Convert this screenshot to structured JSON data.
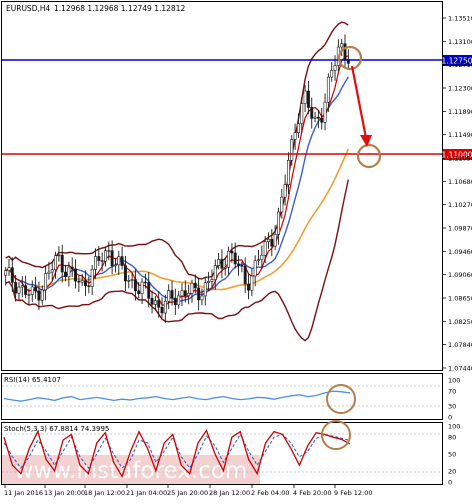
{
  "header": {
    "symbol_tf": "EURUSD,H4",
    "ohlc": "1.12968 1.12968 1.12749 1.12812"
  },
  "rsi_label": "RSI(14) 65.4107",
  "stoch_label": "Stoch(5,3,3) 67.8814 74.3995",
  "watermark": "www.instaforex.com",
  "x_labels": [
    "11 Jan 2016",
    "13 Jan 20:00",
    "18 Jan 12:00",
    "21 Jan 04:00",
    "25 Jan 20:00",
    "28 Jan 12:00",
    "2 Feb 04:00",
    "4 Feb 20:00",
    "9 Feb 12:00"
  ],
  "colors": {
    "candle": "#1a1a1a",
    "bollinger": "#7a0f0f",
    "ma_fast": "#cc0000",
    "ma_mid": "#3a5fcd",
    "ma_slow": "#f0a030",
    "level_upper": "#0000cc",
    "level_lower": "#dd0000",
    "annotation_circle": "#b87d4b",
    "arrow": "#e01010",
    "rsi_line": "#4a90e2",
    "stoch_main": "#cc0000",
    "stoch_signal": "#3a5fcd"
  },
  "chart_data": [
    {
      "type": "line",
      "panel": "price",
      "title": "EURUSD,H4",
      "y_ticks": [
        "1.13510",
        "1.13100",
        "1.12710",
        "1.12300",
        "1.11890",
        "1.11490",
        "1.11090",
        "1.10680",
        "1.10270",
        "1.09870",
        "1.09460",
        "1.09060",
        "1.08650",
        "1.08250",
        "1.07840",
        "1.07440"
      ],
      "ylim": [
        1.0744,
        1.1351
      ],
      "levels": [
        {
          "label": "1.12750",
          "value": 1.1275
        },
        {
          "label": "1.11000",
          "value": 1.11
        }
      ],
      "close_approx": [
        1.0905,
        1.0895,
        1.0878,
        1.0868,
        1.0882,
        1.0905,
        1.0935,
        1.0918,
        1.09,
        1.0885,
        1.0912,
        1.093,
        1.0948,
        1.0925,
        1.0902,
        1.089,
        1.088,
        1.0865,
        1.085,
        1.0858,
        1.087,
        1.0878,
        1.0872,
        1.088,
        1.0902,
        1.092,
        1.0945,
        1.0925,
        1.089,
        1.0915,
        1.0945,
        1.097,
        1.101,
        1.11,
        1.118,
        1.121,
        1.117,
        1.119,
        1.125,
        1.131,
        1.1281
      ]
    },
    {
      "type": "line",
      "panel": "rsi",
      "title": "RSI(14) 65.4107",
      "y_ticks": [
        "100",
        "70",
        "30",
        "0"
      ],
      "ylim": [
        0,
        100
      ],
      "values_approx": [
        50,
        46,
        43,
        47,
        52,
        49,
        45,
        52,
        55,
        47,
        50,
        53,
        49,
        45,
        48,
        46,
        50,
        52,
        55,
        50,
        47,
        51,
        54,
        49,
        47,
        52,
        55,
        50,
        47,
        49,
        53,
        52,
        48,
        53,
        57,
        60,
        55,
        58,
        65,
        70,
        68,
        65
      ]
    },
    {
      "type": "line",
      "panel": "stochastic",
      "title": "Stoch(5,3,3) 67.8814 74.3995",
      "y_ticks": [
        "100",
        "80",
        "50",
        "20",
        "0"
      ],
      "ylim": [
        0,
        100
      ],
      "series": [
        {
          "name": "",
          "values_approx": [
            80,
            30,
            15,
            60,
            90,
            40,
            20,
            75,
            85,
            30,
            15,
            70,
            88,
            35,
            10,
            55,
            90,
            60,
            20,
            70,
            85,
            30,
            15,
            70,
            92,
            50,
            20,
            80,
            90,
            40,
            15,
            70,
            90,
            85,
            60,
            30,
            65,
            88,
            85,
            80,
            76,
            68
          ]
        },
        {
          "name": "",
          "values_approx": [
            70,
            45,
            25,
            45,
            75,
            55,
            30,
            55,
            80,
            45,
            25,
            50,
            78,
            50,
            25,
            40,
            75,
            70,
            35,
            55,
            80,
            45,
            25,
            50,
            82,
            65,
            35,
            60,
            85,
            55,
            30,
            55,
            80,
            85,
            70,
            45,
            55,
            78,
            84,
            82,
            78,
            74
          ]
        }
      ]
    }
  ]
}
